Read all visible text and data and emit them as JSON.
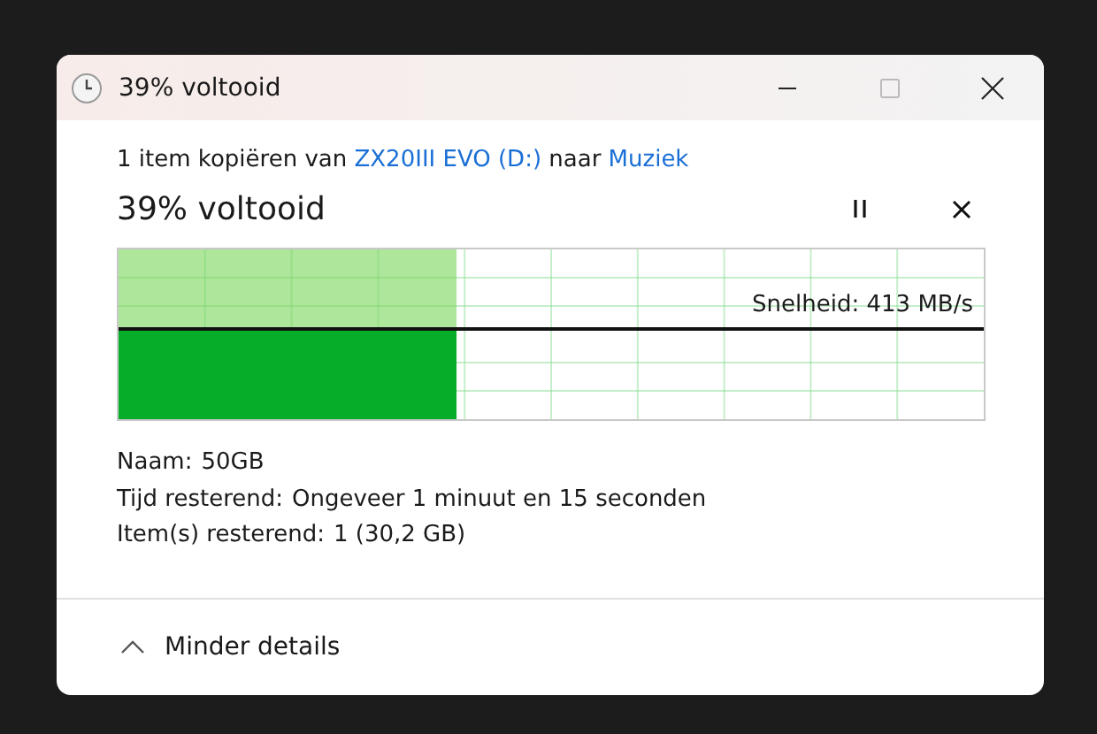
{
  "window": {
    "title": "39% voltooid"
  },
  "description": {
    "prefix": "1 item kopiëren van",
    "source": "ZX20III EVO (D:)",
    "middle": "naar",
    "destination": "Muziek"
  },
  "heading": "39% voltooid",
  "progress": {
    "level": 0.39,
    "speed": "Snelheid: 413 MB/s"
  },
  "details": [
    {
      "label": "Naam:",
      "value": "50GB"
    },
    {
      "label": "Tijd resterend:",
      "value": "Ongeveer 1 minuut en 15 seconden"
    },
    {
      "label": "Item(s) resterend:",
      "value": "1 (30,2 GB)"
    }
  ],
  "footer": {
    "toggle": "Minder details",
    "expanded": true
  }
}
